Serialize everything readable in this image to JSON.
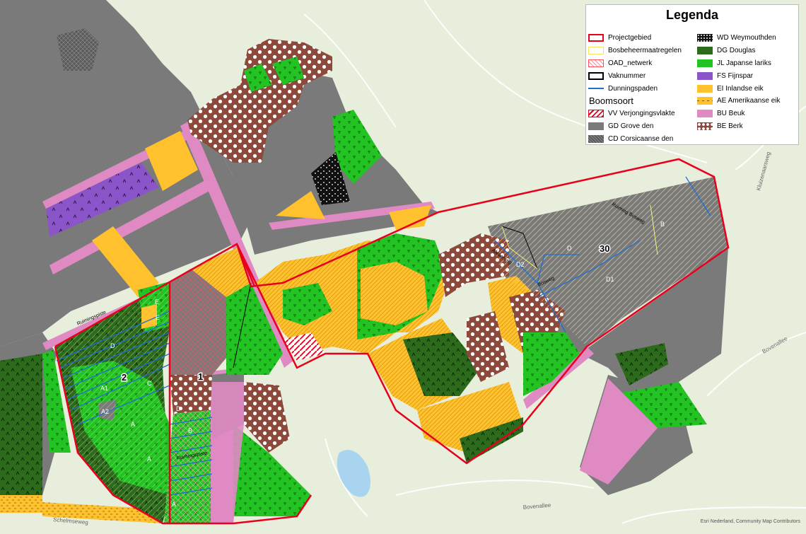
{
  "legend": {
    "title": "Legenda",
    "left_items": [
      {
        "label": "Projectgebied",
        "swatch": "projectgebied"
      },
      {
        "label": "Bosbeheermaatregelen",
        "swatch": "bosbeheer"
      },
      {
        "label": "OAD_netwerk",
        "swatch": "oad"
      },
      {
        "label": "Vaknummer",
        "swatch": "vaknummer"
      },
      {
        "label": "Dunningspaden",
        "swatch": "dunning"
      }
    ],
    "subtitle": "Boomsoort",
    "left_species": [
      {
        "label": "VV Verjongingsvlakte",
        "swatch": "vv"
      },
      {
        "label": "GD Grove den",
        "swatch": "gd"
      },
      {
        "label": "CD Corsicaanse den",
        "swatch": "cd"
      }
    ],
    "right_items": [
      {
        "label": "WD Weymouthden",
        "swatch": "wd"
      },
      {
        "label": "DG Douglas",
        "swatch": "dg"
      },
      {
        "label": "JL Japanse lariks",
        "swatch": "jl"
      },
      {
        "label": "FS Fijnspar",
        "swatch": "fs"
      },
      {
        "label": "EI Inlandse eik",
        "swatch": "ei"
      },
      {
        "label": "AE Amerikaanse eik",
        "swatch": "ae"
      },
      {
        "label": "BU Beuk",
        "swatch": "bu"
      },
      {
        "label": "BE Berk",
        "swatch": "be"
      }
    ]
  },
  "colors": {
    "grove_den": "#7a7a7a",
    "douglas": "#2c6a1c",
    "japanse_lariks": "#22c322",
    "fijnspar": "#8a55c8",
    "inlandse_eik": "#ffc12e",
    "amerikaanse_eik": "#ffc12e",
    "beuk": "#e08ac3",
    "berk": "#8b4a3c",
    "project_border": "#e8001c",
    "dunningspaden": "#1f6fd1",
    "background": "#e8eedc"
  },
  "labels": {
    "vak1": "1",
    "vak2": "2",
    "vak30": "30",
    "A": "A",
    "A1": "A1",
    "A2": "A2",
    "B": "B",
    "C": "C",
    "D": "D",
    "D1": "D1",
    "D2": "D2",
    "E": "E",
    "path1": "Ruimingspiste",
    "path2": "Bosweg",
    "path3": "Afvoerweg",
    "path4": "Ruiming Bosweg"
  },
  "streets": {
    "schelmseweg": "Schelmseweg",
    "bovenallee": "Bovenallee",
    "kluizenaarsweg": "Kluizenaarsweg",
    "bovenallee2": "Bovenallee"
  },
  "credit": "Esri Nederland, Community Map Contributors"
}
